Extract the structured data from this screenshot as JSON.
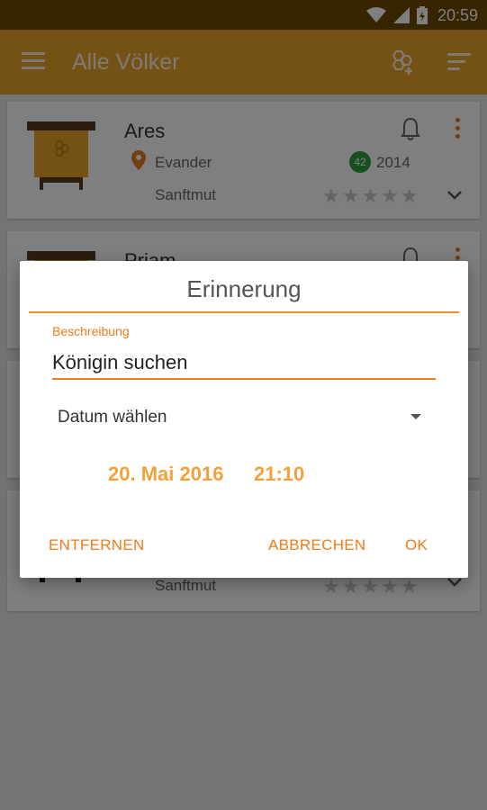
{
  "status_bar": {
    "time": "20:59"
  },
  "app_bar": {
    "title": "Alle Völker"
  },
  "colonies": [
    {
      "name": "Ares",
      "location": "Evander",
      "temperament": "Sanftmut",
      "badge": "42",
      "year": "2014",
      "rating": 0
    },
    {
      "name": "Priam"
    },
    {
      "name": ""
    },
    {
      "name": "",
      "temperament": "Sanftmut",
      "rating": 0
    }
  ],
  "dialog": {
    "title": "Erinnerung",
    "field_label": "Beschreibung",
    "field_value": "Königin suchen",
    "date_select": "Datum wählen",
    "date": "20. Mai 2016",
    "time": "21:10",
    "buttons": {
      "remove": "ENTFERNEN",
      "cancel": "ABBRECHEN",
      "ok": "OK"
    }
  },
  "colors": {
    "app_bar": "#e8a22a",
    "status_bar": "#6f4a00",
    "accent": "#f07b1a",
    "date_time": "#f4a13a",
    "badge": "#2e9e3a"
  }
}
